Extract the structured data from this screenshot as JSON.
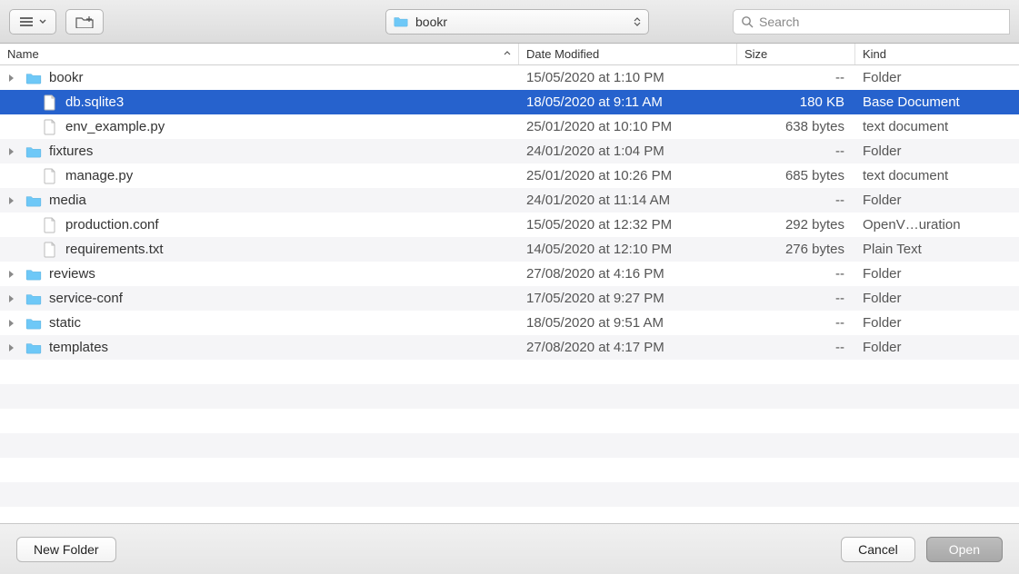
{
  "toolbar": {
    "current_folder": "bookr",
    "search_placeholder": "Search"
  },
  "columns": {
    "name": "Name",
    "date": "Date Modified",
    "size": "Size",
    "kind": "Kind"
  },
  "rows": [
    {
      "name": "bookr",
      "date": "15/05/2020 at 1:10 PM",
      "size": "--",
      "kind": "Folder",
      "icon": "folder",
      "expandable": true,
      "selected": false,
      "indent": 0
    },
    {
      "name": "db.sqlite3",
      "date": "18/05/2020 at 9:11 AM",
      "size": "180 KB",
      "kind": "Base Document",
      "icon": "document",
      "expandable": false,
      "selected": true,
      "indent": 1
    },
    {
      "name": "env_example.py",
      "date": "25/01/2020 at 10:10 PM",
      "size": "638 bytes",
      "kind": "text document",
      "icon": "document",
      "expandable": false,
      "selected": false,
      "indent": 1
    },
    {
      "name": "fixtures",
      "date": "24/01/2020 at 1:04 PM",
      "size": "--",
      "kind": "Folder",
      "icon": "folder",
      "expandable": true,
      "selected": false,
      "indent": 0
    },
    {
      "name": "manage.py",
      "date": "25/01/2020 at 10:26 PM",
      "size": "685 bytes",
      "kind": "text document",
      "icon": "document",
      "expandable": false,
      "selected": false,
      "indent": 1
    },
    {
      "name": "media",
      "date": "24/01/2020 at 11:14 AM",
      "size": "--",
      "kind": "Folder",
      "icon": "folder",
      "expandable": true,
      "selected": false,
      "indent": 0
    },
    {
      "name": "production.conf",
      "date": "15/05/2020 at 12:32 PM",
      "size": "292 bytes",
      "kind": "OpenV…uration",
      "icon": "document",
      "expandable": false,
      "selected": false,
      "indent": 1
    },
    {
      "name": "requirements.txt",
      "date": "14/05/2020 at 12:10 PM",
      "size": "276 bytes",
      "kind": "Plain Text",
      "icon": "document",
      "expandable": false,
      "selected": false,
      "indent": 1
    },
    {
      "name": "reviews",
      "date": "27/08/2020 at 4:16 PM",
      "size": "--",
      "kind": "Folder",
      "icon": "folder",
      "expandable": true,
      "selected": false,
      "indent": 0
    },
    {
      "name": "service-conf",
      "date": "17/05/2020 at 9:27 PM",
      "size": "--",
      "kind": "Folder",
      "icon": "folder",
      "expandable": true,
      "selected": false,
      "indent": 0
    },
    {
      "name": "static",
      "date": "18/05/2020 at 9:51 AM",
      "size": "--",
      "kind": "Folder",
      "icon": "folder",
      "expandable": true,
      "selected": false,
      "indent": 0
    },
    {
      "name": "templates",
      "date": "27/08/2020 at 4:17 PM",
      "size": "--",
      "kind": "Folder",
      "icon": "folder",
      "expandable": true,
      "selected": false,
      "indent": 0
    }
  ],
  "footer": {
    "new_folder": "New Folder",
    "cancel": "Cancel",
    "open": "Open"
  },
  "icons": {
    "folder_color": "#6ec8f7",
    "folder_stroke": "#4aa8da"
  }
}
